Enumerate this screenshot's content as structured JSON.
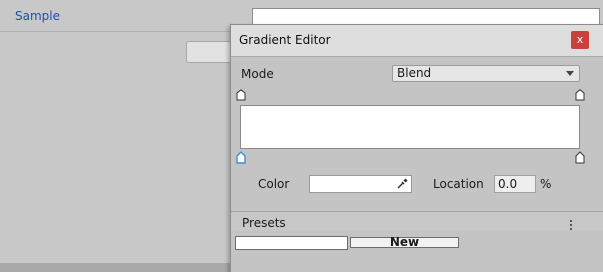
{
  "inspector": {
    "sample_label": "Sample"
  },
  "window": {
    "title": "Gradient Editor",
    "close_label": "x",
    "mode_label": "Mode",
    "mode_value": "Blend",
    "color_label": "Color",
    "location_label": "Location",
    "location_value": "0.0",
    "percent_sign": "%",
    "presets_label": "Presets",
    "menu_icon": "⋮",
    "new_label": "New"
  },
  "icons": {
    "alpha_marker": "alpha-stop-marker-icon",
    "color_marker": "color-stop-marker-icon",
    "eyedropper": "eyedropper-icon",
    "dropdown": "chevron-down-icon",
    "menu": "vertical-dots-icon"
  },
  "colors": {
    "close_button": "#c9413b",
    "selected_marker": "#3f8fd8",
    "link_text": "#1f4fa8"
  }
}
